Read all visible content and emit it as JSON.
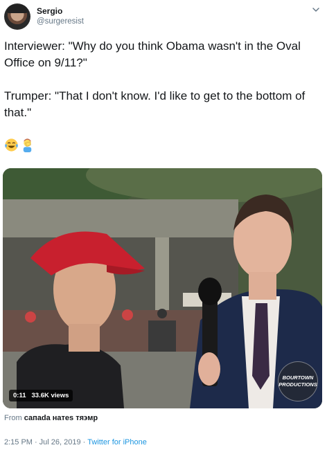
{
  "author": {
    "display_name": "Sergio",
    "handle": "@surgeresist"
  },
  "tweet": {
    "line1": "Interviewer: \"Why do you think Obama wasn't in the Oval Office on 9/11?\"",
    "line2": "Trumper: \"That I don't know. I'd like to get to the bottom of that.\"",
    "emojis": [
      "face-with-tears-of-joy",
      "man-facepalming"
    ]
  },
  "media": {
    "duration": "0:11",
    "views": "33.6K views",
    "watermark_line1": "BOURTOWN",
    "watermark_line2": "PRODUCTIONS",
    "icon": "video-player"
  },
  "from_line": {
    "prefix": "From",
    "name": "сапаda натеs тя϶мр"
  },
  "meta": {
    "time": "2:15 PM",
    "separator": "·",
    "date": "Jul 26, 2019",
    "source": "Twitter for iPhone"
  },
  "colors": {
    "text": "#14171a",
    "secondary": "#657786",
    "link": "#1b95e0"
  }
}
